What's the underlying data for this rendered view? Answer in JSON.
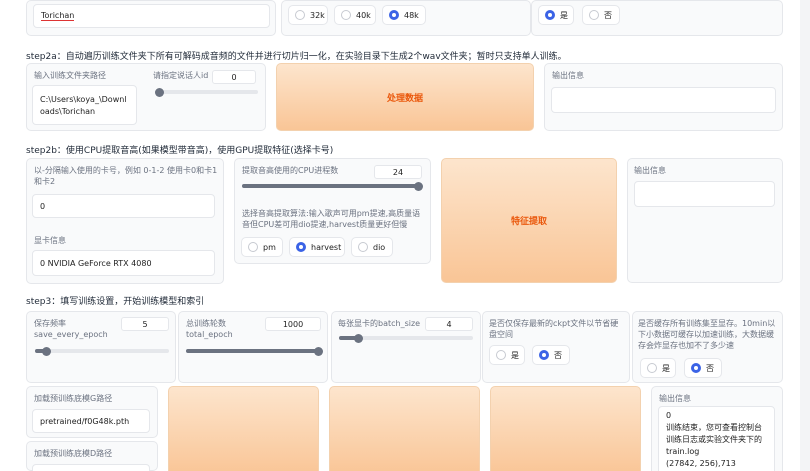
{
  "top": {
    "name_value": "Torichan",
    "sr_options": [
      "32k",
      "40k",
      "48k"
    ],
    "pitch_options": [
      "是",
      "否"
    ]
  },
  "step2a": {
    "title": "step2a：自动遍历训练文件夹下所有可解码成音频的文件并进行切片归一化，在实验目录下生成2个wav文件夹；暂时只支持单人训练。",
    "folder_label": "输入训练文件夹路径",
    "folder_value": "C:\\Users\\koya_\\Downloads\\Torichan",
    "speaker_label": "请指定说话人id",
    "speaker_value": "0",
    "process_button": "处理数据",
    "output_label": "输出信息"
  },
  "step2b": {
    "title": "step2b：使用CPU提取音高(如果模型带音高)，使用GPU提取特征(选择卡号)",
    "gpu_label": "以-分隔输入使用的卡号，例如 0-1-2 使用卡0和卡1和卡2",
    "gpu_value": "0",
    "gpuinfo_label": "显卡信息",
    "gpuinfo_value": "0 NVIDIA GeForce RTX 4080",
    "cpu_label": "提取音高使用的CPU进程数",
    "cpu_value": "24",
    "algo_label": "选择音高提取算法:输入歌声可用pm提速,高质量语音但CPU差可用dio提速,harvest质量更好但慢",
    "algo_options": [
      "pm",
      "harvest",
      "dio"
    ],
    "extract_button": "特征提取",
    "output_label": "输出信息"
  },
  "step3": {
    "title": "step3：填写训练设置，开始训练模型和索引",
    "save_freq_label": "保存频率\nsave_every_epoch",
    "save_freq_value": "5",
    "total_epoch_label": "总训练轮数\ntotal_epoch",
    "total_epoch_value": "1000",
    "batch_label": "每张显卡的batch_size",
    "batch_value": "4",
    "latest_label": "是否仅保存最新的ckpt文件以节省硬盘空间",
    "latest_options": [
      "是",
      "否"
    ],
    "cache_label": "是否缓存所有训练集至显存。10min以下小数据可缓存以加速训练，大数据缓存会炸显存也加不了多少速",
    "cache_options": [
      "是",
      "否"
    ],
    "pretrained_g_label": "加载预训练底模G路径",
    "pretrained_g_value": "pretrained/f0G48k.pth",
    "pretrained_d_label": "加载预训练底模D路径",
    "output_label": "输出信息",
    "output_text": "0\n训练结束，您可查看控制台训练日志或实验文件夹下的train.log\n(27842, 256),713"
  },
  "colors": {
    "accent": "#3b63e6",
    "button_text": "#ea580c",
    "button_bg": "#f9c596"
  }
}
